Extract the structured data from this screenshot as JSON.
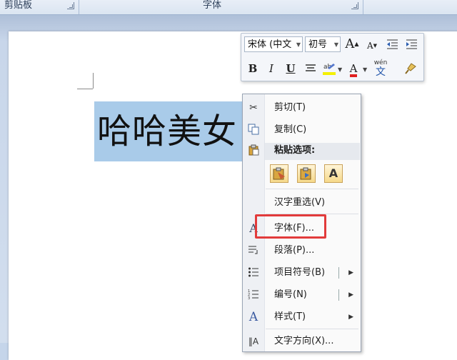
{
  "ribbon": {
    "clipboard_label": "剪贴板",
    "font_label": "字体"
  },
  "document": {
    "selected_text": "哈哈美女"
  },
  "mini_toolbar": {
    "font_name": "宋体 (中文",
    "font_size": "初号",
    "grow_font": "A",
    "shrink_font": "A",
    "bold": "B",
    "italic": "I",
    "underline": "U",
    "font_color_glyph": "A",
    "font_color": "#e02020",
    "phonetic_top": "wén",
    "phonetic_bottom": "文"
  },
  "context_menu": {
    "items": [
      {
        "label": "剪切(T)",
        "icon": "scissors-icon"
      },
      {
        "label": "复制(C)",
        "icon": "copy-icon"
      },
      {
        "label": "粘贴选项:",
        "icon": "paste-icon"
      },
      {
        "label": "汉字重选(V)",
        "icon": ""
      },
      {
        "label": "字体(F)...",
        "icon": "font-icon"
      },
      {
        "label": "段落(P)...",
        "icon": "paragraph-icon"
      },
      {
        "label": "项目符号(B)",
        "icon": "bullets-icon"
      },
      {
        "label": "编号(N)",
        "icon": "numbering-icon"
      },
      {
        "label": "样式(T)",
        "icon": "styles-icon"
      },
      {
        "label": "文字方向(X)...",
        "icon": "text-direction-icon"
      }
    ],
    "paste_text_only_glyph": "A"
  },
  "colors": {
    "selection": "#a9cbe9",
    "highlight_border": "#e23b3b"
  }
}
